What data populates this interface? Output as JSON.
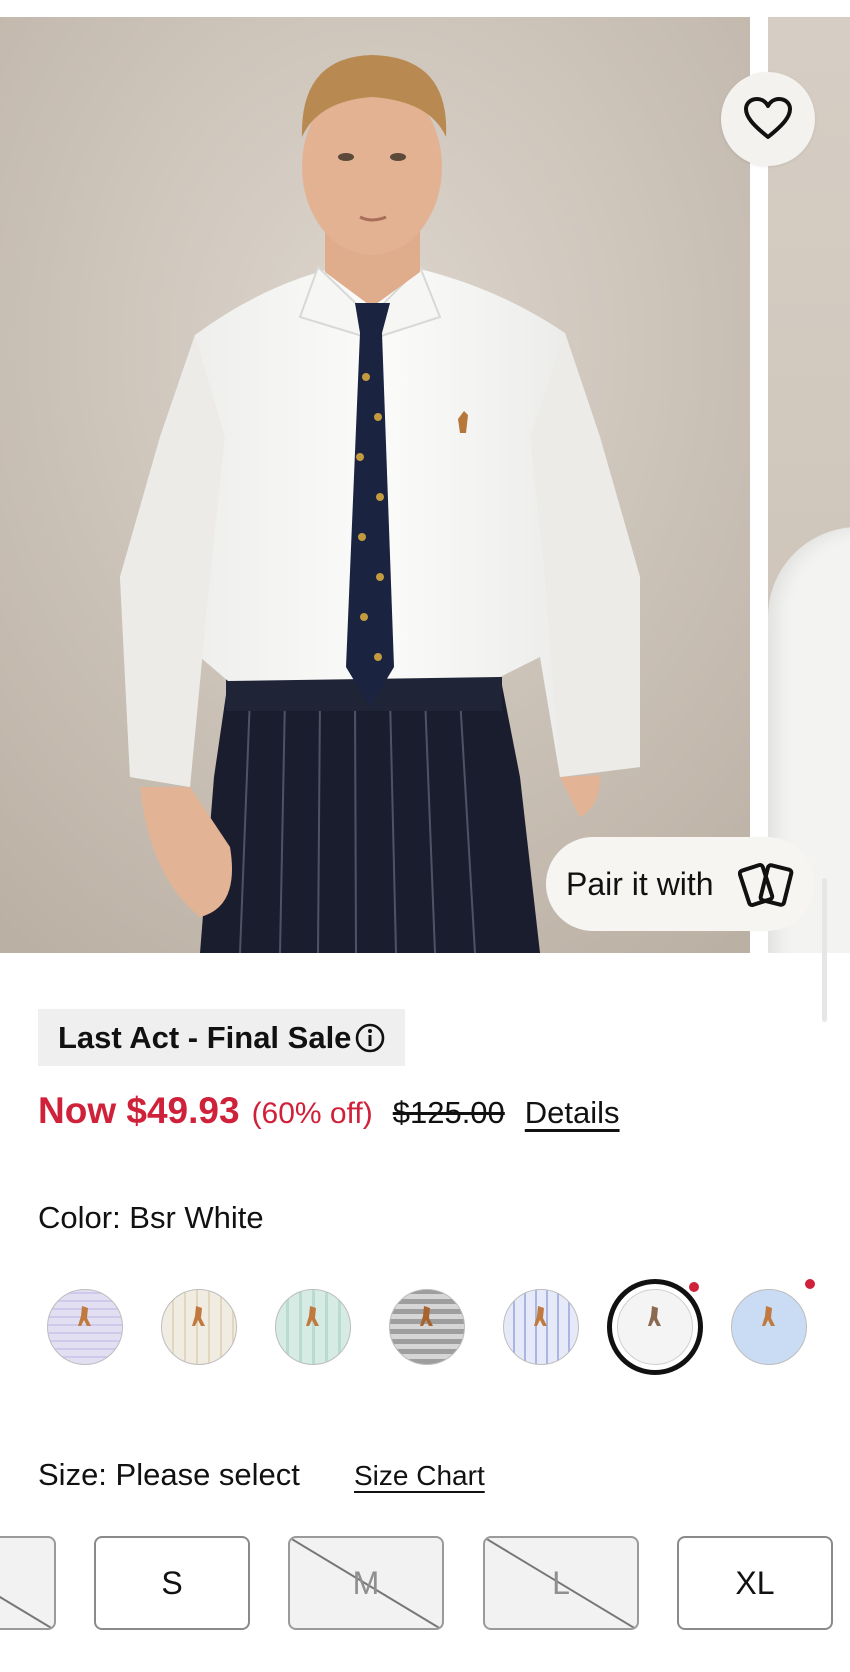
{
  "product": {
    "badge": "Last Act - Final Sale",
    "price_now": "Now $49.93",
    "discount": "(60% off)",
    "price_original": "$125.00",
    "details_link": "Details",
    "color_label": "Color: Bsr White",
    "size_label": "Size: Please select",
    "size_chart_link": "Size Chart",
    "pair_label": "Pair it with",
    "accent_color": "#d0213a"
  },
  "swatches": [
    {
      "name": "lavender check"
    },
    {
      "name": "tan check"
    },
    {
      "name": "mint check"
    },
    {
      "name": "gray gingham"
    },
    {
      "name": "blue plaid"
    },
    {
      "name": "white",
      "selected": true,
      "dot": true
    },
    {
      "name": "light blue",
      "dot": true
    }
  ],
  "sizes": [
    {
      "label": "",
      "available": false
    },
    {
      "label": "S",
      "available": true
    },
    {
      "label": "M",
      "available": false
    },
    {
      "label": "L",
      "available": false
    },
    {
      "label": "XL",
      "available": true
    }
  ]
}
